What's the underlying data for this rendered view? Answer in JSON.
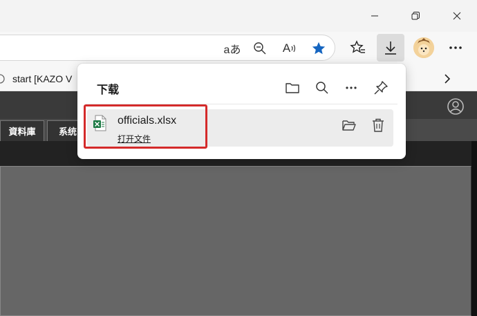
{
  "address_bar": {
    "read_aloud_label": "aあ",
    "read_aloud_glyph": "A"
  },
  "favorites": {
    "items": [
      {
        "label": "start [KAZO V"
      }
    ]
  },
  "page": {
    "tabs": [
      {
        "label": "資料庫"
      },
      {
        "label": "系统"
      }
    ]
  },
  "downloads": {
    "title": "下载",
    "items": [
      {
        "file_name": "officials.xlsx",
        "action_label": "打开文件",
        "icon": "excel-file-icon"
      }
    ]
  },
  "colors": {
    "accent_star": "#1565c0",
    "highlight_border": "#d42a2a",
    "excel_green": "#1d7a45"
  }
}
